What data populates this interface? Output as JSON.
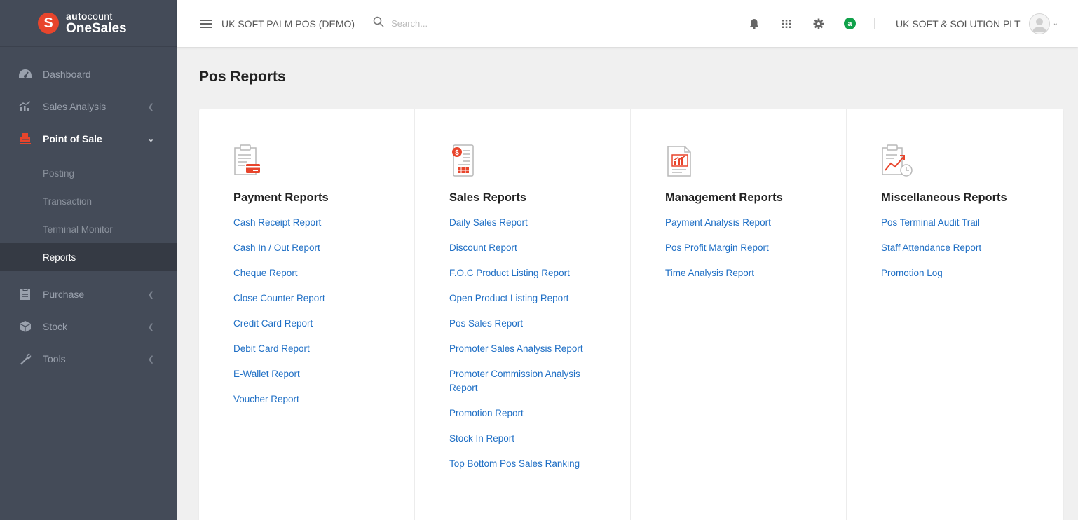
{
  "brand": {
    "top_bold": "auto",
    "top_light": "count",
    "name": "OneSales",
    "logo_letter": "S"
  },
  "sidebar": {
    "items": [
      {
        "label": "Dashboard",
        "icon": "dashboard-icon"
      },
      {
        "label": "Sales Analysis",
        "icon": "chart-icon"
      },
      {
        "label": "Point of Sale",
        "icon": "register-icon"
      },
      {
        "label": "Purchase",
        "icon": "clipboard-icon"
      },
      {
        "label": "Stock",
        "icon": "box-icon"
      },
      {
        "label": "Tools",
        "icon": "wrench-icon"
      }
    ],
    "pos_sub": [
      "Posting",
      "Transaction",
      "Terminal Monitor",
      "Reports"
    ]
  },
  "topbar": {
    "company": "UK SOFT PALM POS (DEMO)",
    "search_placeholder": "Search...",
    "status_letter": "a",
    "user": "UK SOFT & SOLUTION PLT"
  },
  "page": {
    "title": "Pos Reports"
  },
  "columns": [
    {
      "title": "Payment Reports",
      "icon": "payment-report-icon",
      "links": [
        "Cash Receipt Report",
        "Cash In / Out Report",
        "Cheque Report",
        "Close Counter Report",
        "Credit Card Report",
        "Debit Card Report",
        "E-Wallet Report",
        "Voucher Report"
      ]
    },
    {
      "title": "Sales Reports",
      "icon": "sales-report-icon",
      "links": [
        "Daily Sales Report",
        "Discount Report",
        "F.O.C Product Listing Report",
        "Open Product Listing Report",
        "Pos Sales Report",
        "Promoter Sales Analysis Report",
        "Promoter Commission Analysis Report",
        "Promotion Report",
        "Stock In Report",
        "Top Bottom Pos Sales Ranking"
      ]
    },
    {
      "title": "Management Reports",
      "icon": "management-report-icon",
      "links": [
        "Payment Analysis Report",
        "Pos Profit Margin Report",
        "Time Analysis Report"
      ]
    },
    {
      "title": "Miscellaneous Reports",
      "icon": "misc-report-icon",
      "links": [
        "Pos Terminal Audit Trail",
        "Staff Attendance Report",
        "Promotion Log"
      ]
    }
  ],
  "colors": {
    "sidebar_bg": "#444b58",
    "accent": "#e8452c",
    "link": "#1f6fc5",
    "status": "#10a14a"
  }
}
